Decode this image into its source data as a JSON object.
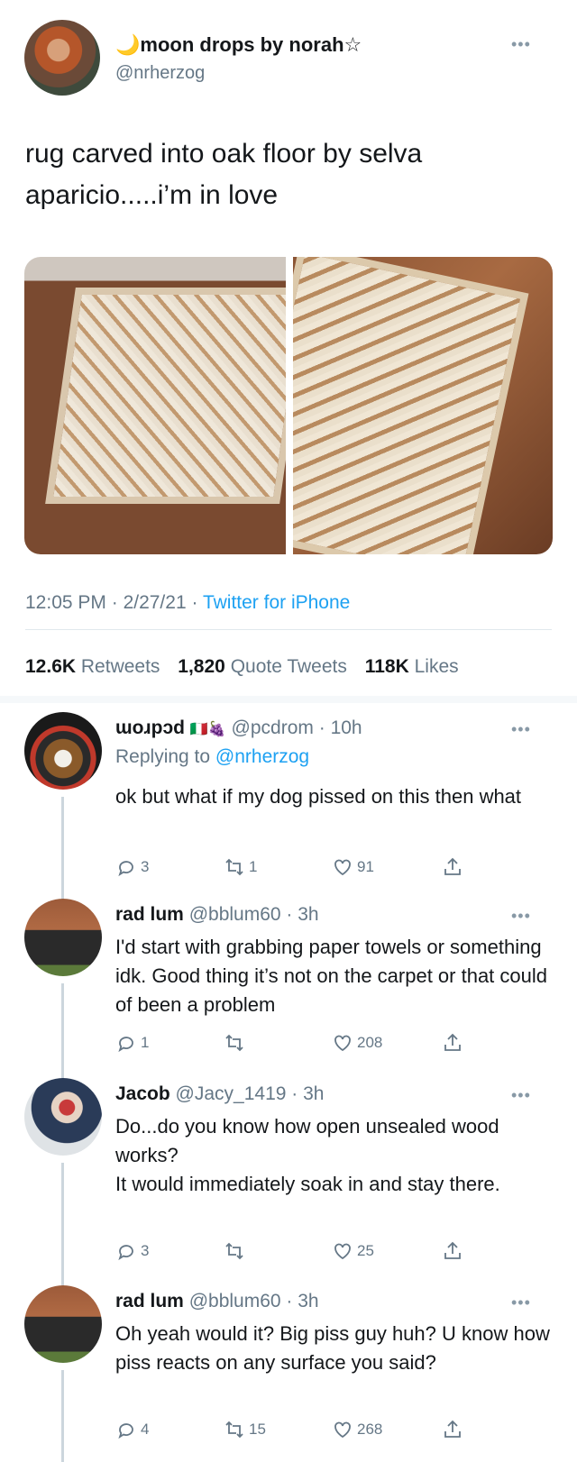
{
  "main_tweet": {
    "author_name": "🌙moon drops by norah☆",
    "author_handle": "@nrherzog",
    "text_line1": "rug carved into oak floor by selva",
    "text_line2": "aparicio.....i’m in love",
    "time": "12:05 PM",
    "date": "2/27/21",
    "source": "Twitter for iPhone",
    "retweets_count": "12.6K",
    "retweets_label": "Retweets",
    "quote_count": "1,820",
    "quote_label": "Quote Tweets",
    "likes_count": "118K",
    "likes_label": "Likes"
  },
  "replies": [
    {
      "name": "ɯoɹpɔd",
      "flags": "🇮🇹🍇",
      "handle": "@pcdrom",
      "time": "10h",
      "replying_label": "Replying to",
      "replying_to": "@nrherzog",
      "text": "ok but what if my dog pissed on this then what",
      "reply_count": "3",
      "retweet_count": "1",
      "like_count": "91"
    },
    {
      "name": "rad lum",
      "handle": "@bblum60",
      "time": "3h",
      "text": "I'd start with grabbing paper towels or something idk. Good thing it’s not on the carpet or that could of been a problem",
      "reply_count": "1",
      "retweet_count": "",
      "like_count": "208"
    },
    {
      "name": "Jacob",
      "handle": "@Jacy_1419",
      "time": "3h",
      "text_line1": "Do...do you know how open unsealed wood works?",
      "text_line2": "It would immediately soak in and stay there.",
      "reply_count": "3",
      "retweet_count": "",
      "like_count": "25"
    },
    {
      "name": "rad lum",
      "handle": "@bblum60",
      "time": "3h",
      "text": "Oh yeah would it? Big piss guy huh? U know how piss reacts on any surface you said?",
      "reply_count": "4",
      "retweet_count": "15",
      "like_count": "268"
    }
  ],
  "icons": [
    "more-icon",
    "reply-icon",
    "retweet-icon",
    "like-icon",
    "share-icon"
  ],
  "colors": {
    "link": "#1da1f2",
    "secondary_text": "#657786",
    "divider": "#e1e8ed"
  }
}
